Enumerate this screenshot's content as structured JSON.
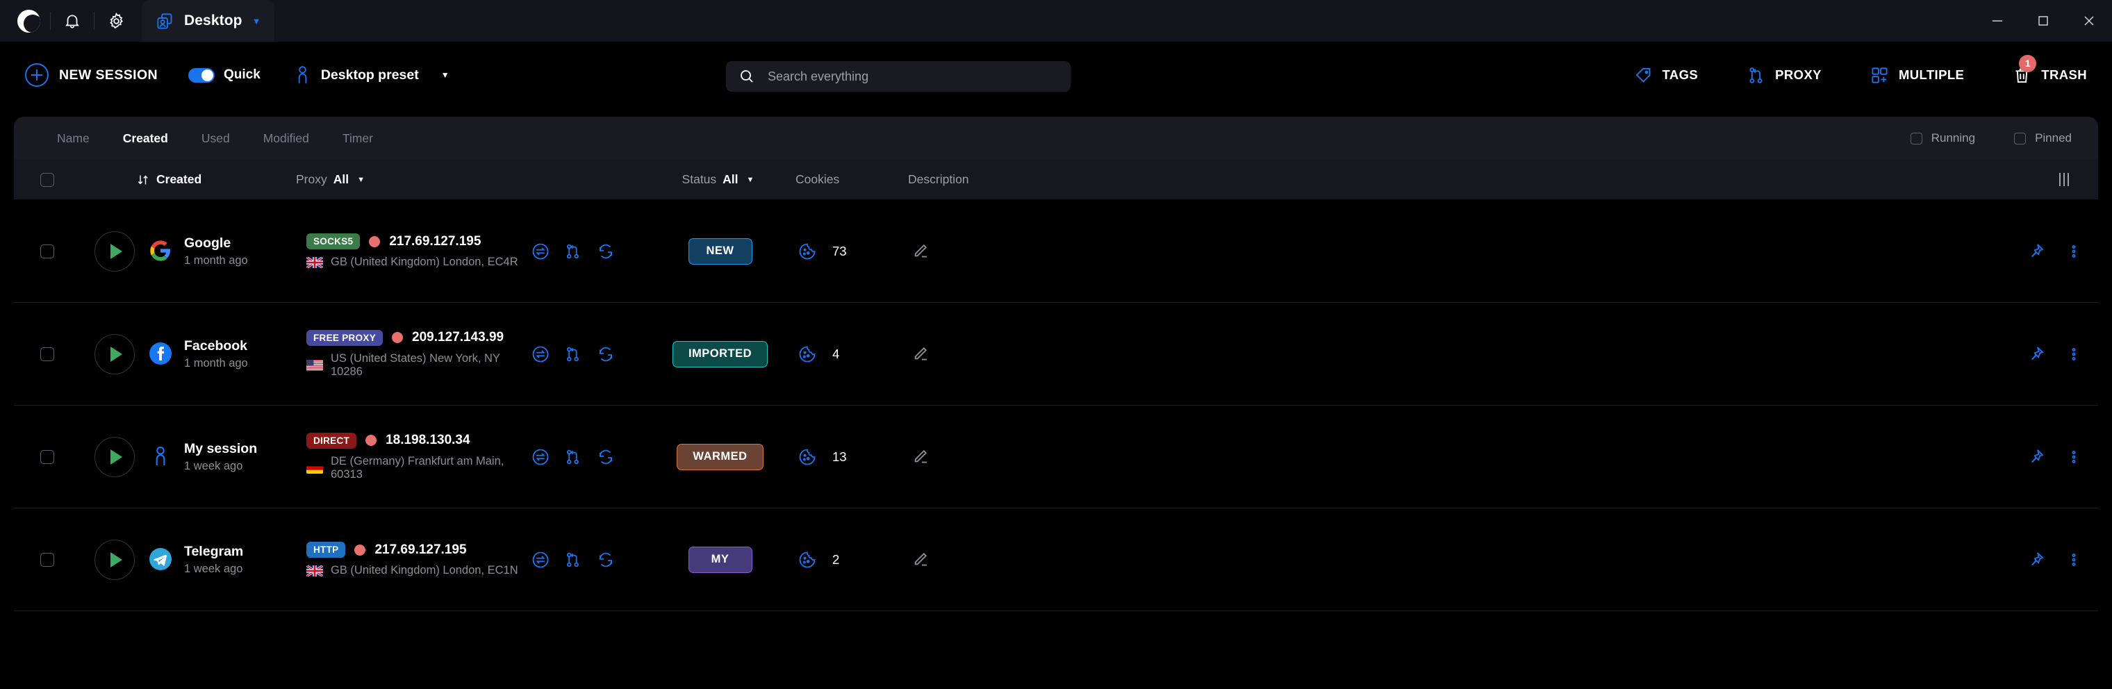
{
  "titlebar": {
    "app_logo_icon": "app-logo",
    "notifications_icon": "bell-icon",
    "settings_icon": "gear-icon",
    "tab_icon": "profiles-icon",
    "tab_title": "Desktop",
    "tab_caret_icon": "chevron-down-icon",
    "minimize_icon": "minimize-icon",
    "maximize_icon": "maximize-icon",
    "close_icon": "close-icon"
  },
  "toolbar": {
    "new_session_label": "NEW SESSION",
    "new_session_icon": "plus-circle-icon",
    "quick_label": "Quick",
    "quick_toggle_on": true,
    "preset_icon": "person-icon",
    "preset_label": "Desktop preset",
    "preset_caret_icon": "chevron-down-icon",
    "search_placeholder": "Search everything",
    "search_value": "",
    "search_icon": "search-icon",
    "tags_label": "TAGS",
    "tags_icon": "tag-icon",
    "proxy_label": "PROXY",
    "proxy_icon": "proxy-branch-icon",
    "multiple_label": "MULTIPLE",
    "multiple_icon": "grid-plus-icon",
    "trash_label": "TRASH",
    "trash_icon": "trash-icon",
    "trash_badge": "1"
  },
  "filterbar": {
    "sort_tabs": [
      {
        "label": "Name",
        "active": false
      },
      {
        "label": "Created",
        "active": true
      },
      {
        "label": "Used",
        "active": false
      },
      {
        "label": "Modified",
        "active": false
      },
      {
        "label": "Timer",
        "active": false
      }
    ],
    "running_label": "Running",
    "running_checked": false,
    "pinned_label": "Pinned",
    "pinned_checked": false
  },
  "columns": {
    "select_all_checked": false,
    "sort_icon": "sort-arrows-icon",
    "created_label": "Created",
    "proxy_label": "Proxy",
    "proxy_filter_value": "All",
    "proxy_caret_icon": "chevron-down-icon",
    "status_label": "Status",
    "status_filter_value": "All",
    "status_caret_icon": "chevron-down-icon",
    "cookies_label": "Cookies",
    "description_label": "Description",
    "column_settings_icon": "columns-settings-icon"
  },
  "accent_colors": {
    "blue": "#1a73e8",
    "green_play": "#3fa861",
    "red_dot": "#e8706f",
    "badge_socks5": "#3d7a4a",
    "badge_free_proxy": "#454ba0",
    "badge_direct": "#8c1717",
    "badge_http": "#1f72c2",
    "status_new_bg": "#134061",
    "status_new_border": "#2196f3",
    "status_imported_bg": "#0d4a4a",
    "status_imported_border": "#22c3c3",
    "status_warmed_bg": "#6b4334",
    "status_warmed_border": "#e2703a",
    "status_my_bg": "#453a7a",
    "status_my_border": "#8c59d6"
  },
  "rows": [
    {
      "checked": false,
      "play_icon": "play-icon",
      "favicon": "google-icon",
      "name": "Google",
      "age": "1 month ago",
      "proxy_type": "SOCKS5",
      "proxy_type_color": "#3d7a4a",
      "ip": "217.69.127.195",
      "status_dot_color": "#e8706f",
      "flag": "gb",
      "geo": "GB (United Kingdom) London, EC4R",
      "action_icons": [
        "transfer-icon",
        "branch-icon",
        "sync-icon"
      ],
      "status": "NEW",
      "status_bg": "#134061",
      "status_border": "#2196f3",
      "cookies_icon": "cookie-icon",
      "cookies": "73",
      "description": "",
      "edit_icon": "pencil-icon",
      "pin_icon": "pin-icon",
      "more_icon": "more-vertical-icon"
    },
    {
      "checked": false,
      "play_icon": "play-icon",
      "favicon": "facebook-icon",
      "name": "Facebook",
      "age": "1 month ago",
      "proxy_type": "FREE PROXY",
      "proxy_type_color": "#454ba0",
      "ip": "209.127.143.99",
      "status_dot_color": "#e8706f",
      "flag": "us",
      "geo": "US (United States) New York, NY 10286",
      "action_icons": [
        "transfer-icon",
        "branch-icon",
        "sync-icon"
      ],
      "status": "IMPORTED",
      "status_bg": "#0d4a4a",
      "status_border": "#22c3c3",
      "cookies_icon": "cookie-icon",
      "cookies": "4",
      "description": "",
      "edit_icon": "pencil-icon",
      "pin_icon": "pin-icon",
      "more_icon": "more-vertical-icon"
    },
    {
      "checked": false,
      "play_icon": "play-icon",
      "favicon": "person-icon",
      "name": "My session",
      "age": "1 week ago",
      "proxy_type": "DIRECT",
      "proxy_type_color": "#8c1717",
      "ip": "18.198.130.34",
      "status_dot_color": "#e8706f",
      "flag": "de",
      "geo": "DE (Germany) Frankfurt am Main, 60313",
      "action_icons": [
        "transfer-icon",
        "branch-icon",
        "sync-icon"
      ],
      "status": "WARMED",
      "status_bg": "#6b4334",
      "status_border": "#e2703a",
      "cookies_icon": "cookie-icon",
      "cookies": "13",
      "description": "",
      "edit_icon": "pencil-icon",
      "pin_icon": "pin-icon",
      "more_icon": "more-vertical-icon"
    },
    {
      "checked": false,
      "play_icon": "play-icon",
      "favicon": "telegram-icon",
      "name": "Telegram",
      "age": "1 week ago",
      "proxy_type": "HTTP",
      "proxy_type_color": "#1f72c2",
      "ip": "217.69.127.195",
      "status_dot_color": "#e8706f",
      "flag": "gb",
      "geo": "GB (United Kingdom) London, EC1N",
      "action_icons": [
        "transfer-icon",
        "branch-icon",
        "sync-icon"
      ],
      "status": "MY",
      "status_bg": "#453a7a",
      "status_border": "#8c59d6",
      "cookies_icon": "cookie-icon",
      "cookies": "2",
      "description": "",
      "edit_icon": "pencil-icon",
      "pin_icon": "pin-icon",
      "more_icon": "more-vertical-icon"
    }
  ]
}
